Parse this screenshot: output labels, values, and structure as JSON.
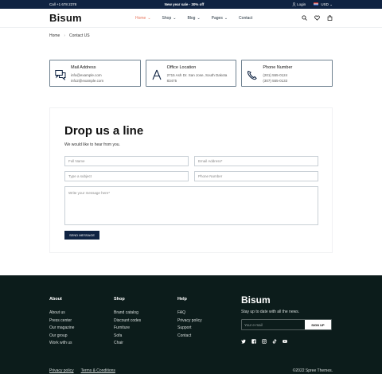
{
  "topbar": {
    "phone": "Call +1 678 2378",
    "promo": "New year sale - 30% off",
    "login": "Login",
    "currency": "USD"
  },
  "header": {
    "logo": "Bisum",
    "nav": [
      {
        "label": "Home",
        "active": true
      },
      {
        "label": "Shop"
      },
      {
        "label": "Blog"
      },
      {
        "label": "Pages"
      },
      {
        "label": "Contact"
      }
    ]
  },
  "breadcrumb": {
    "home": "Home",
    "current": "Contact US"
  },
  "cards": [
    {
      "title": "Mail Address",
      "lines": [
        "info@example.com",
        "info2@example.com"
      ],
      "icon": "chat-icon"
    },
    {
      "title": "Office Location",
      "lines": [
        "2715 Ash Dr. San Jose, South Dakota",
        "83475"
      ],
      "icon": "location-icon"
    },
    {
      "title": "Phone Number",
      "lines": [
        "(201) 555-0124",
        "(307) 555-0133"
      ],
      "icon": "phone-icon"
    }
  ],
  "form": {
    "heading": "Drop us a line",
    "subtitle": "We would like to hear from you.",
    "full_name_placeholder": "Full Name",
    "email_placeholder": "Email Address*",
    "subject_placeholder": "Type a subject",
    "phone_placeholder": "Phone Number",
    "message_placeholder": "Write your message here*",
    "send_label": "SEND MESSAGE"
  },
  "footer": {
    "about": {
      "heading": "About",
      "items": [
        "About us",
        "Press center",
        "Our magazine",
        "Our group",
        "Work with us"
      ]
    },
    "shop": {
      "heading": "Shop",
      "items": [
        "Brand catalog",
        "Discount codes",
        "Furniture",
        "Sofa",
        "Chair"
      ]
    },
    "help": {
      "heading": "Help",
      "items": [
        "FAQ",
        "Privacy policy",
        "Support",
        "Contact"
      ]
    },
    "logo": "Bisum",
    "tagline": "Stay up to date with all the news.",
    "newsletter_placeholder": "Your e-mail",
    "signup_label": "SIGN UP",
    "social_icons": [
      "twitter-icon",
      "facebook-icon",
      "instagram-icon",
      "tiktok-icon",
      "youtube-icon"
    ],
    "bottom_links": [
      "Privacy policy",
      "Terms & Conditions"
    ],
    "copyright": "©2022 Spree Themes."
  },
  "colors": {
    "navy": "#0f2342",
    "accent": "#e8765c",
    "footer_bg": "#0c1c1b"
  }
}
